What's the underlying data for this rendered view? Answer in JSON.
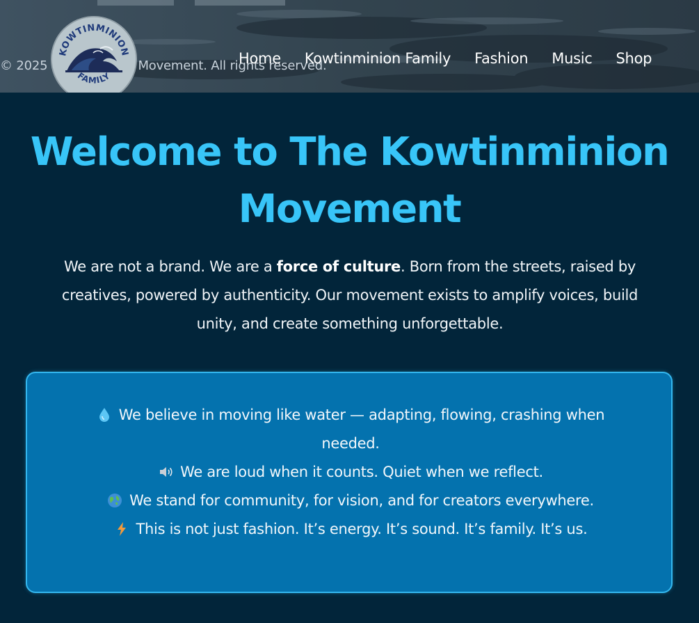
{
  "header": {
    "footer_text": "© 2025 Kowtinminion Movement. All rights reserved.",
    "logo": {
      "top_text": "KOWTINMINION",
      "bottom_text": "FAMILY",
      "icon": "wave-icon"
    },
    "nav": [
      {
        "label": "Home"
      },
      {
        "label": "Kowtinminion Family"
      },
      {
        "label": "Fashion"
      },
      {
        "label": "Music"
      },
      {
        "label": "Shop"
      }
    ]
  },
  "hero": {
    "title": "Welcome to The Kowtinminion Movement",
    "intro_before": "We are not a brand. We are a ",
    "intro_bold": "force of culture",
    "intro_after": ". Born from the streets, raised by creatives, powered by authenticity. Our movement exists to amplify voices, build unity, and create something unforgettable."
  },
  "beliefs": [
    {
      "icon": "droplet-icon",
      "text": "We believe in moving like water — adapting, flowing, crashing when needed."
    },
    {
      "icon": "speaker-icon",
      "text": "We are loud when it counts. Quiet when we reflect."
    },
    {
      "icon": "globe-icon",
      "text": "We stand for community, for vision, and for creators everywhere."
    },
    {
      "icon": "lightning-icon",
      "text": "This is not just fashion. It’s energy. It’s sound. It’s family. It’s us."
    }
  ],
  "colors": {
    "page_background": "#02253a",
    "title_accent": "#38c5f8",
    "card_background": "#0472ae",
    "card_border": "#34b7ef"
  }
}
